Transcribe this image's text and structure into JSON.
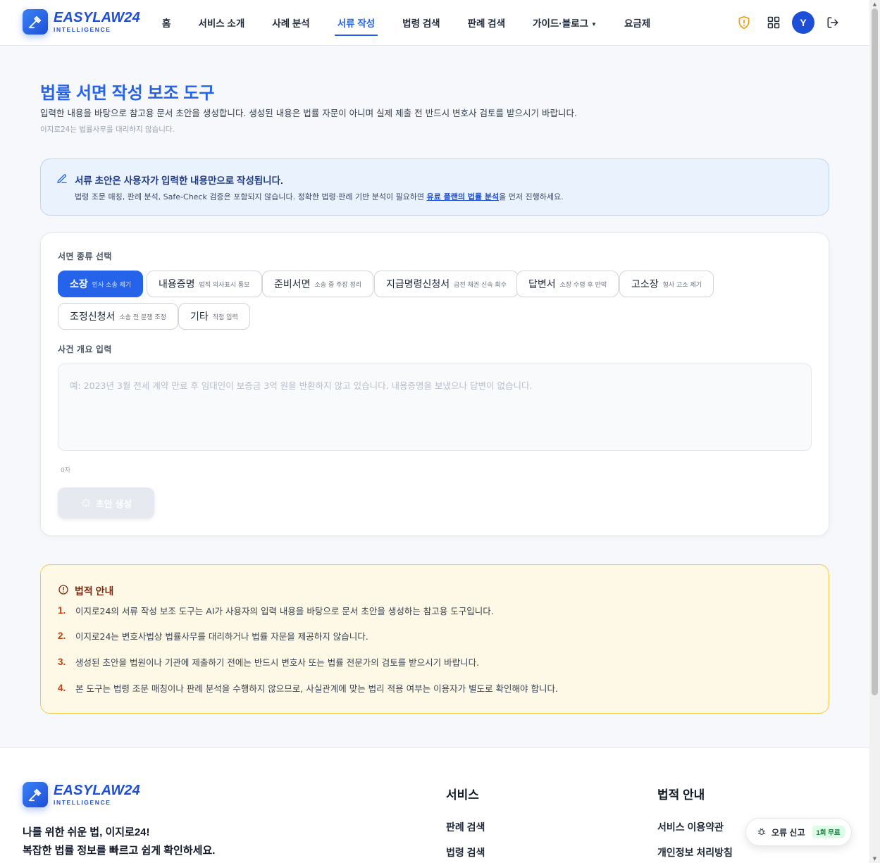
{
  "brand": {
    "name": "EASYLAW24",
    "sub": "INTELLIGENCE",
    "accent": "#2563eb"
  },
  "nav": {
    "items": [
      {
        "label": "홈"
      },
      {
        "label": "서비스 소개"
      },
      {
        "label": "사례 분석"
      },
      {
        "label": "서류 작성"
      },
      {
        "label": "법령 검색"
      },
      {
        "label": "판례 검색"
      },
      {
        "label": "가이드·블로그"
      },
      {
        "label": "요금제"
      }
    ],
    "active": "서류 작성",
    "avatar_initial": "Y",
    "icons": [
      "shield-alert-icon",
      "grid-apps-icon",
      "avatar",
      "logout-icon"
    ]
  },
  "page": {
    "title": "법률 서면 작성 보조 도구",
    "description": "입력한 내용을 바탕으로 참고용 문서 초안을 생성합니다. 생성된 내용은 법률 자문이 아니며 실제 제출 전 반드시 변호사 검토를 받으시기 바랍니다.",
    "note": "이지로24는 법률사무를 대리하지 않습니다."
  },
  "notice": {
    "title": "서류 초안은 사용자가 입력한 내용만으로 작성됩니다.",
    "body_before": "법령 조문 매칭, 판례 분석, Safe-Check 검증은 포함되지 않습니다. 정확한 법령·판례 기반 분석이 필요하면 ",
    "link": "유료 플랜의 법률 분석",
    "body_after": "을 먼저 진행하세요."
  },
  "form": {
    "doc_type_label": "서면 종류 선택",
    "doc_types": [
      {
        "name": "소장",
        "desc": "민사 소송 제기"
      },
      {
        "name": "내용증명",
        "desc": "법적 의사표시 통보"
      },
      {
        "name": "준비서면",
        "desc": "소송 중 주장 정리"
      },
      {
        "name": "지급명령신청서",
        "desc": "금전 채권 신속 회수"
      },
      {
        "name": "답변서",
        "desc": "소장 수령 후 반박"
      },
      {
        "name": "고소장",
        "desc": "형사 고소 제기"
      },
      {
        "name": "조정신청서",
        "desc": "소송 전 분쟁 조정"
      },
      {
        "name": "기타",
        "desc": "직접 입력"
      }
    ],
    "selected_doc_type": "소장",
    "case_label": "사건 개요 입력",
    "case_placeholder": "예: 2023년 3월 전세 계약 만료 후 임대인이 보증금 3억 원을 반환하지 않고 있습니다. 내용증명을 보냈으나 답변이 없습니다.",
    "case_value": "",
    "char_count": "0자",
    "generate_label": "초안 생성"
  },
  "legal": {
    "title": "법적 안내",
    "items": [
      {
        "num": "1.",
        "text": "이지로24의 서류 작성 보조 도구는 AI가 사용자의 입력 내용을 바탕으로 문서 초안을 생성하는 참고용 도구입니다."
      },
      {
        "num": "2.",
        "text": "이지로24는 변호사법상 법률사무를 대리하거나 법률 자문을 제공하지 않습니다."
      },
      {
        "num": "3.",
        "text": "생성된 초안을 법원이나 기관에 제출하기 전에는 반드시 변호사 또는 법률 전문가의 검토를 받으시기 바랍니다."
      },
      {
        "num": "4.",
        "text": "본 도구는 법령 조문 매칭이나 판례 분석을 수행하지 않으므로, 사실관계에 맞는 법리 적용 여부는 이용자가 별도로 확인해야 합니다."
      }
    ]
  },
  "footer": {
    "slogan_1": "나를 위한 쉬운 법, 이지로24!",
    "slogan_2": "복잡한 법률 정보를 빠르고 쉽게 확인하세요.",
    "col_service_title": "서비스",
    "col_service_links": [
      "판례 검색",
      "법령 검색"
    ],
    "col_legal_title": "법적 안내",
    "col_legal_links": [
      "서비스 이용약관",
      "개인정보 처리방침"
    ]
  },
  "report": {
    "label": "오류 신고",
    "badge": "1회 무료"
  }
}
